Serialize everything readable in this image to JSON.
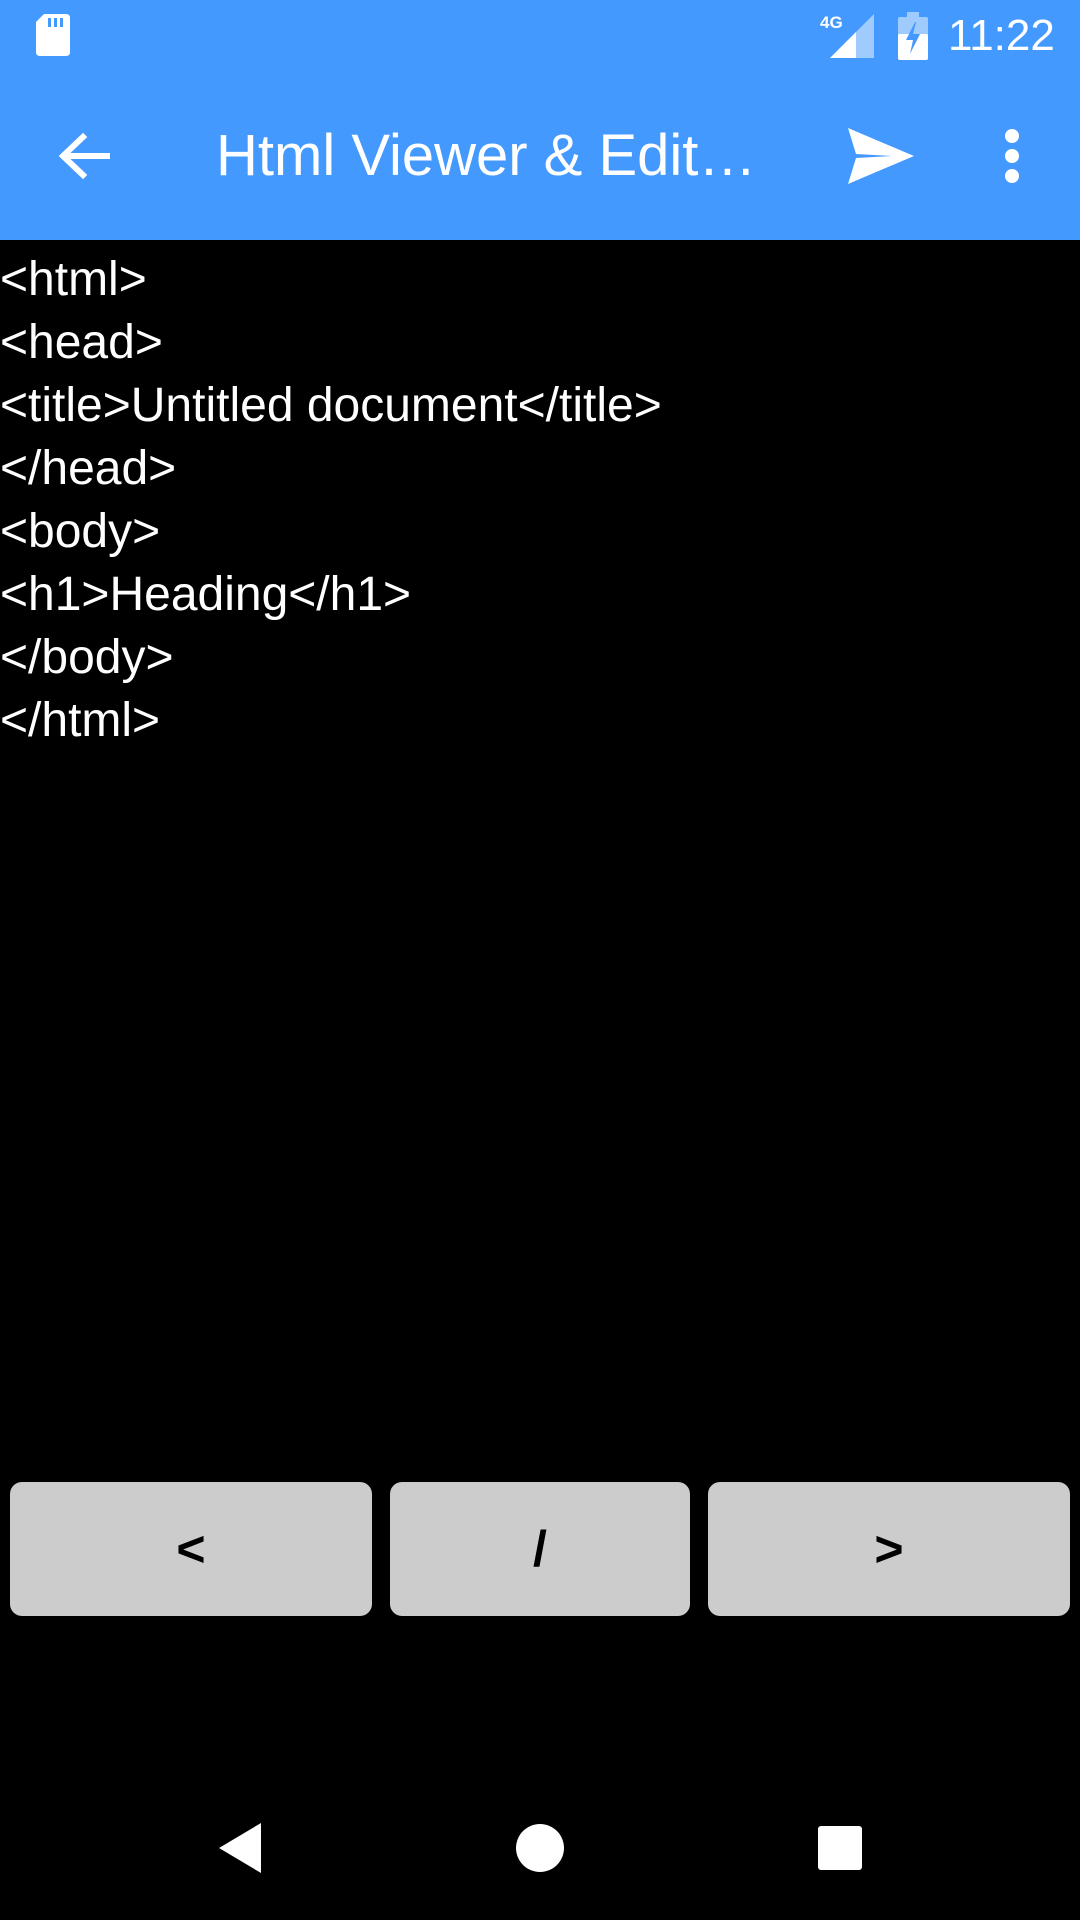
{
  "status_bar": {
    "time": "11:22",
    "network": "4G",
    "icons": [
      "sd-card-icon",
      "signal-icon",
      "battery-charging-icon"
    ]
  },
  "app_bar": {
    "title": "Html Viewer & Edit…",
    "back_icon": "arrow-left-icon",
    "send_icon": "send-icon",
    "overflow_icon": "more-vert-icon"
  },
  "editor": {
    "lines": [
      "<html>",
      "<head>",
      "<title>Untitled document</title>",
      "</head>",
      "<body>",
      "<h1>Heading</h1>",
      "</body>",
      "</html>"
    ]
  },
  "keys": {
    "open_bracket": "<",
    "slash": "/",
    "close_bracket": ">"
  },
  "nav_bar": {
    "icons": [
      "nav-back-icon",
      "nav-home-icon",
      "nav-recents-icon"
    ]
  },
  "colors": {
    "primary": "#4499ff",
    "editor_background": "#000000",
    "editor_text": "#ffffff",
    "key_background": "#cccccc"
  }
}
